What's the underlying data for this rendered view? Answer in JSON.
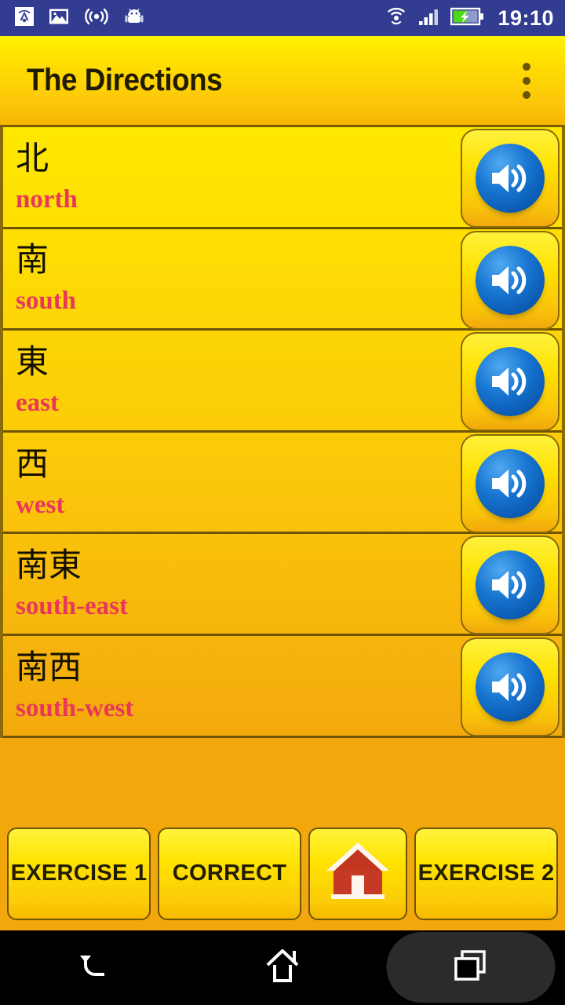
{
  "status_bar": {
    "background_color": "#323C90",
    "time": "19:10",
    "left_icons": [
      {
        "name": "cast-screen-icon"
      },
      {
        "name": "photo-image-icon"
      },
      {
        "name": "broadcast-signal-icon"
      },
      {
        "name": "android-robot-icon"
      }
    ],
    "right_icons": [
      {
        "name": "wifi-icon"
      },
      {
        "name": "cellular-signal-icon"
      },
      {
        "name": "battery-charging-icon"
      }
    ]
  },
  "action_bar": {
    "title": "The Directions",
    "overflow_menu": "overflow-menu-icon",
    "background_gradient_start": "#FFF200",
    "background_gradient_end": "#F5B400",
    "title_color": "#211C00"
  },
  "list": {
    "english_color": "#E8375B",
    "kanji_color": "#141000",
    "speaker_icon": "speaker-sound-icon",
    "items": [
      {
        "kanji": "北",
        "english": "north"
      },
      {
        "kanji": "南",
        "english": "south"
      },
      {
        "kanji": "東",
        "english": "east"
      },
      {
        "kanji": "西",
        "english": "west"
      },
      {
        "kanji": "南東",
        "english": "south-east"
      },
      {
        "kanji": "南西",
        "english": "south-west"
      }
    ]
  },
  "bottom_bar": {
    "buttons": [
      {
        "label": "EXERCISE 1",
        "name": "exercise-1-button"
      },
      {
        "label": "CORRECT",
        "name": "correct-button"
      },
      {
        "label": "",
        "name": "home-button",
        "icon": "house-home-icon"
      },
      {
        "label": "EXERCISE 2",
        "name": "exercise-2-button"
      }
    ],
    "background_color": "#F2A80C",
    "text_color": "#231D00"
  },
  "nav_bar": {
    "background_color": "#000000",
    "buttons": [
      {
        "name": "nav-back-icon"
      },
      {
        "name": "nav-home-icon"
      },
      {
        "name": "nav-recents-icon"
      }
    ]
  }
}
